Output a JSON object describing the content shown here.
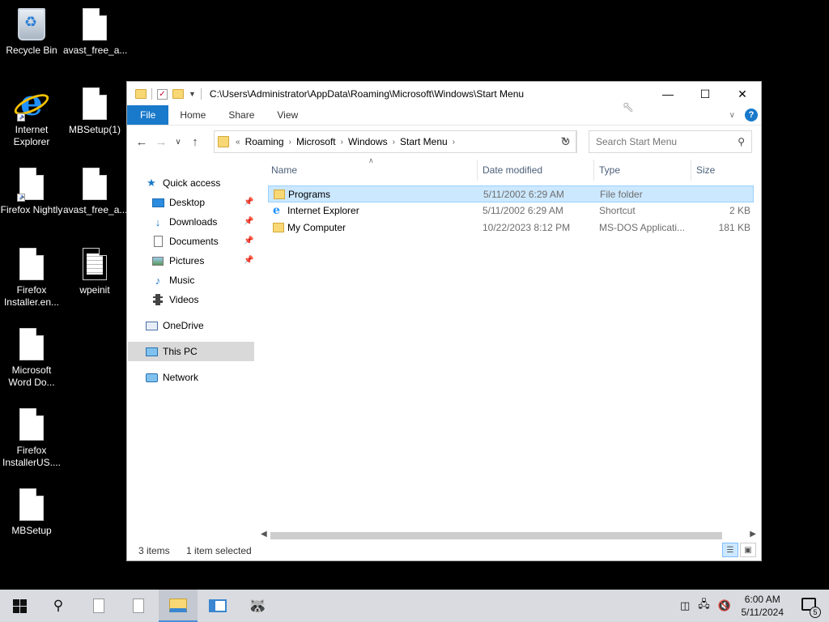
{
  "desktop": {
    "icons": [
      {
        "label": "Recycle Bin",
        "icon": "recycle-bin-icon"
      },
      {
        "label": "avast_free_a...",
        "icon": "file-icon"
      },
      {
        "label": "Internet Explorer",
        "icon": "internet-explorer-icon"
      },
      {
        "label": "MBSetup(1)",
        "icon": "file-icon"
      },
      {
        "label": "Firefox Nightly",
        "icon": "file-icon"
      },
      {
        "label": "avast_free_a...",
        "icon": "file-icon"
      },
      {
        "label": "Firefox Installer.en...",
        "icon": "file-icon"
      },
      {
        "label": "wpeinit",
        "icon": "text-file-icon"
      },
      {
        "label": "Microsoft Word Do...",
        "icon": "file-icon"
      },
      {
        "label": "Firefox InstallerUS....",
        "icon": "file-icon"
      },
      {
        "label": "MBSetup",
        "icon": "file-icon"
      }
    ]
  },
  "window": {
    "title_path": "C:\\Users\\Administrator\\AppData\\Roaming\\Microsoft\\Windows\\Start Menu",
    "ribbon_tabs": [
      "File",
      "Home",
      "Share",
      "View"
    ],
    "breadcrumb": [
      "Roaming",
      "Microsoft",
      "Windows",
      "Start Menu"
    ],
    "breadcrumb_overflow": "«",
    "search_placeholder": "Search Start Menu",
    "nav": {
      "quick_access": "Quick access",
      "desktop": "Desktop",
      "downloads": "Downloads",
      "documents": "Documents",
      "pictures": "Pictures",
      "music": "Music",
      "videos": "Videos",
      "onedrive": "OneDrive",
      "this_pc": "This PC",
      "network": "Network"
    },
    "columns": {
      "name": "Name",
      "date": "Date modified",
      "type": "Type",
      "size": "Size"
    },
    "files": [
      {
        "name": "Programs",
        "date": "5/11/2002 6:29 AM",
        "type": "File folder",
        "size": "",
        "icon": "folder-icon",
        "selected": true
      },
      {
        "name": "Internet Explorer",
        "date": "5/11/2002 6:29 AM",
        "type": "Shortcut",
        "size": "2 KB",
        "icon": "internet-explorer-icon",
        "selected": false
      },
      {
        "name": "My Computer",
        "date": "10/22/2023 8:12 PM",
        "type": "MS-DOS Applicati...",
        "size": "181 KB",
        "icon": "folder-icon",
        "selected": false
      }
    ],
    "status": {
      "count": "3 items",
      "selection": "1 item selected"
    }
  },
  "taskbar": {
    "time": "6:00 AM",
    "date": "5/11/2024",
    "notification_count": "5"
  },
  "colors": {
    "accent": "#1979ca",
    "selection": "#cce8ff",
    "taskbar": "#d9dbe0"
  }
}
